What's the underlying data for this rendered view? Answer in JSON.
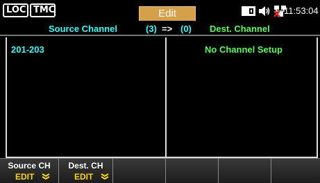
{
  "topbar": {
    "loc_badge": "LOC",
    "tmc_badge": "TMC",
    "mode": "Edit",
    "time": "11:53:04"
  },
  "header": {
    "source_label": "Source Channel",
    "source_count": "(3)",
    "arrow": "=>",
    "dest_count": "(0)",
    "dest_label": "Dest. Channel"
  },
  "source_panel": {
    "items": [
      "201-203"
    ]
  },
  "dest_panel": {
    "message": "No Channel Setup"
  },
  "softkeys": [
    {
      "title": "Source CH",
      "value": "EDIT",
      "icon": "chevron-down-icon"
    },
    {
      "title": "Dest. CH",
      "value": "EDIT",
      "icon": "chevron-down-icon"
    },
    {
      "title": "",
      "value": ""
    },
    {
      "title": "",
      "value": ""
    },
    {
      "title": "",
      "value": ""
    },
    {
      "title": "",
      "value": ""
    }
  ],
  "status_icons": [
    "card-icon",
    "speaker-muted-icon",
    "network-disconnected-icon"
  ],
  "colors": {
    "cyan": "#33ffff",
    "green": "#55ff55",
    "yellow": "#ffd700",
    "tab": "#d4a14a"
  }
}
